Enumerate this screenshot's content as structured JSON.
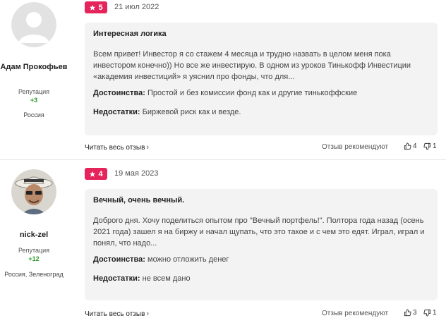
{
  "reviews": [
    {
      "author_name": "Адам Прокофьев",
      "rep_label": "Репутация",
      "rep_value": "+3",
      "location": "Россия",
      "rating": "5",
      "date": "21 июл 2022",
      "title": "Интересная логика",
      "text": "Всем привет! Инвестор я со стажем 4 месяца и трудно назвать в целом меня пока инвестором конечно)) Но все же инвестирую. В одном из уроков Тинькофф Инвестиции «академия инвестиций» я уяснил про фонды, что для...",
      "pros_label": "Достоинства:",
      "pros": "Простой и без комиссии фонд как и другие тинькоффские",
      "cons_label": "Недостатки:",
      "cons": "Биржевой риск как и везде.",
      "read_more": "Читать весь отзыв",
      "recommend": "Отзыв рекомендуют",
      "likes": "4",
      "dislikes": "1"
    },
    {
      "author_name": "nick-zel",
      "rep_label": "Репутация",
      "rep_value": "+12",
      "location": "Россия, Зеленоград",
      "rating": "4",
      "date": "19 мая 2023",
      "title": "Вечный, очень вечный.",
      "text": "Доброго дня. Хочу поделиться опытом про \"Вечный портфель!\". Полтора года назад (осень 2021 года) зашел я на биржу и начал щупать, что это такое и с чем это едят. Играл, играл и понял, что надо...",
      "pros_label": "Достоинства:",
      "pros": "можно отложить денег",
      "cons_label": "Недостатки:",
      "cons": "не всем дано",
      "read_more": "Читать весь отзыв",
      "recommend": "Отзыв рекомендуют",
      "likes": "3",
      "dislikes": "1"
    }
  ],
  "colors": {
    "badge": "#e5245c",
    "reputation": "#2a9a2a",
    "card_bg": "#f3f3f3"
  }
}
